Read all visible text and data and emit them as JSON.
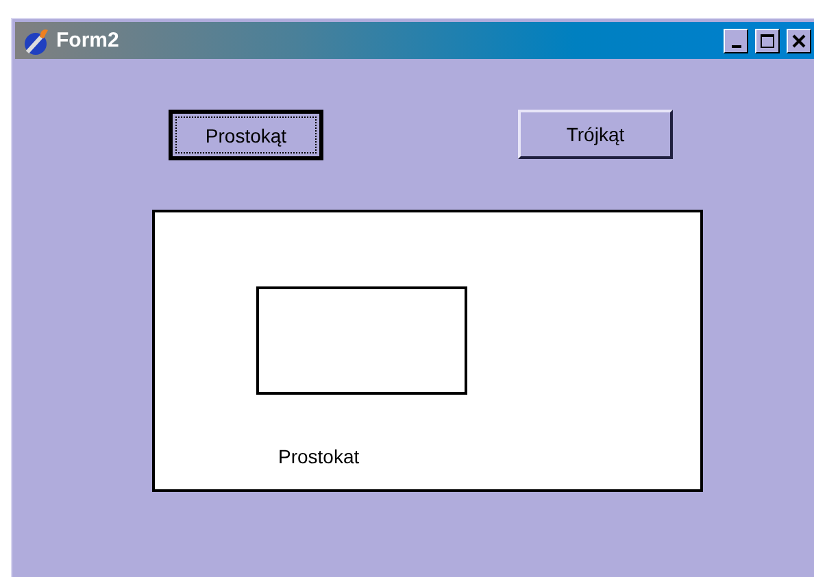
{
  "window": {
    "title": "Form2",
    "controls": [
      {
        "kind": "minimize"
      },
      {
        "kind": "maximize"
      },
      {
        "kind": "close"
      }
    ]
  },
  "buttons": [
    {
      "label": "Prostokąt",
      "focused": true
    },
    {
      "label": "Trójkąt",
      "focused": false
    }
  ],
  "canvas": {
    "shapes": [
      {
        "kind": "rectangle"
      },
      {
        "kind": "label",
        "text": "Prostokat"
      }
    ]
  }
}
